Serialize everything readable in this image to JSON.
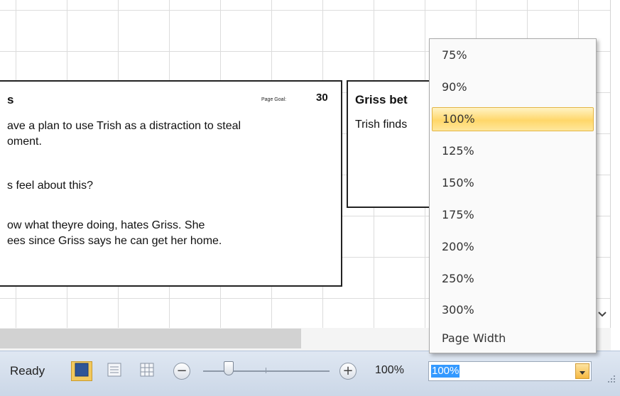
{
  "canvas": {
    "cards": [
      {
        "title": "s",
        "page_goal_label": "Page Goal:",
        "page_goal_value": "30",
        "lines": [
          "ave a plan to use Trish as a distraction to steal",
          "oment.",
          "s feel about this?",
          "ow what theyre doing, hates Griss. She",
          "ees since Griss says he can get her home."
        ]
      },
      {
        "title": "Griss bet",
        "lines": [
          "Trish finds"
        ]
      }
    ]
  },
  "status_bar": {
    "status": "Ready",
    "zoom_percent": "100%",
    "zoom_combo_value": "100%"
  },
  "zoom_dropdown": {
    "selected": "100%",
    "options": [
      "75%",
      "90%",
      "100%",
      "125%",
      "150%",
      "175%",
      "200%",
      "250%",
      "300%",
      "Page Width"
    ]
  },
  "colors": {
    "selection_highlight": "#ffd76a",
    "status_bar": "#dfe7f2",
    "text_selection": "#3399ff",
    "active_view_button": "#f2c95d"
  },
  "icons": {
    "view_buttons": [
      "page-view-icon",
      "outline-view-icon",
      "grid-view-icon"
    ],
    "zoom_out": "minus-circle-icon",
    "zoom_in": "plus-circle-icon",
    "combo_arrow": "dropdown-arrow-icon",
    "grip": "resize-grip-icon",
    "chevron": "chevron-down-icon"
  }
}
